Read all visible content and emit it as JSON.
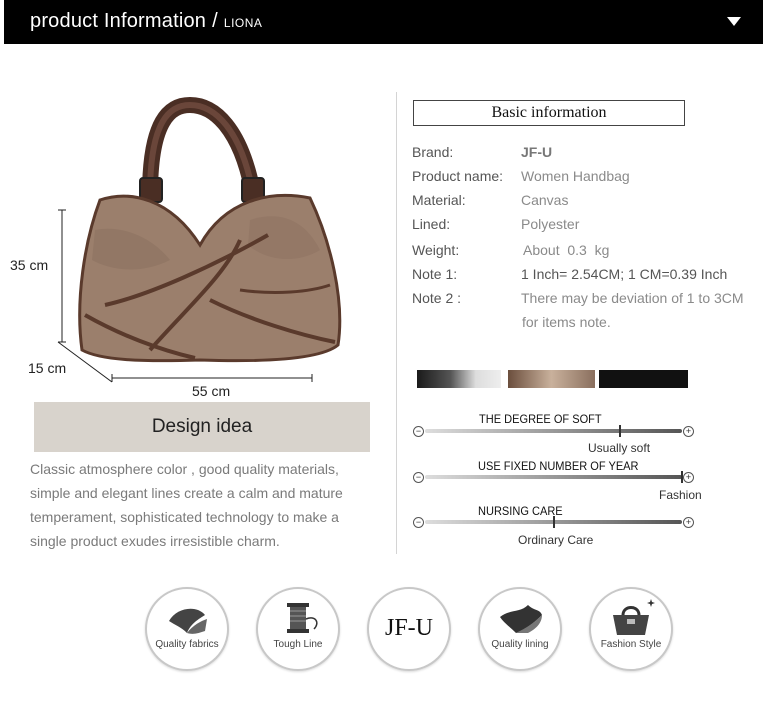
{
  "header": {
    "title": "product Information",
    "separator": "/",
    "brand": "LIONA"
  },
  "dimensions": {
    "height": "35 cm",
    "depth": "15 cm",
    "width": "55 cm"
  },
  "design": {
    "title": "Design idea",
    "text": "Classic atmosphere color , good quality materials, simple and elegant lines create a calm and mature temperament, sophisticated technology to make a single product exudes irresistible charm."
  },
  "basic": {
    "title": "Basic information",
    "rows": [
      {
        "label": "Brand:",
        "value": "JF-U"
      },
      {
        "label": "Product name:",
        "value": "Women Handbag"
      },
      {
        "label": "Material:",
        "value": "Canvas"
      },
      {
        "label": "Lined:",
        "value": "Polyester"
      },
      {
        "label": "Weight:",
        "value": "About  0.3  kg"
      },
      {
        "label": "Note 1:",
        "value": "1 Inch= 2.54CM; 1 CM=0.39 Inch"
      },
      {
        "label": "Note 2 :",
        "value": "There may be deviation of 1 to 3CM"
      },
      {
        "label": "",
        "value": "for items note."
      }
    ]
  },
  "scales": [
    {
      "title": "THE DEGREE OF SOFT",
      "value": "Usually soft",
      "level": 0.76
    },
    {
      "title": "USE FIXED NUMBER OF YEAR",
      "value": "Fashion",
      "level": 1.0
    },
    {
      "title": "NURSING CARE",
      "value": "Ordinary Care",
      "level": 0.5
    }
  ],
  "features": [
    {
      "label": "Quality fabrics",
      "icon": "fabric-icon"
    },
    {
      "label": "Tough Line",
      "icon": "thread-spool-icon"
    },
    {
      "label": "JF-U",
      "icon": "brand-logo"
    },
    {
      "label": "Quality lining",
      "icon": "lining-icon"
    },
    {
      "label": "Fashion Style",
      "icon": "handbag-icon"
    }
  ],
  "colors": {
    "header_bg": "#000000",
    "bag_canvas": "#9b7f6c",
    "bag_trim": "#5a3a2c",
    "design_box": "#d8d3cc"
  }
}
